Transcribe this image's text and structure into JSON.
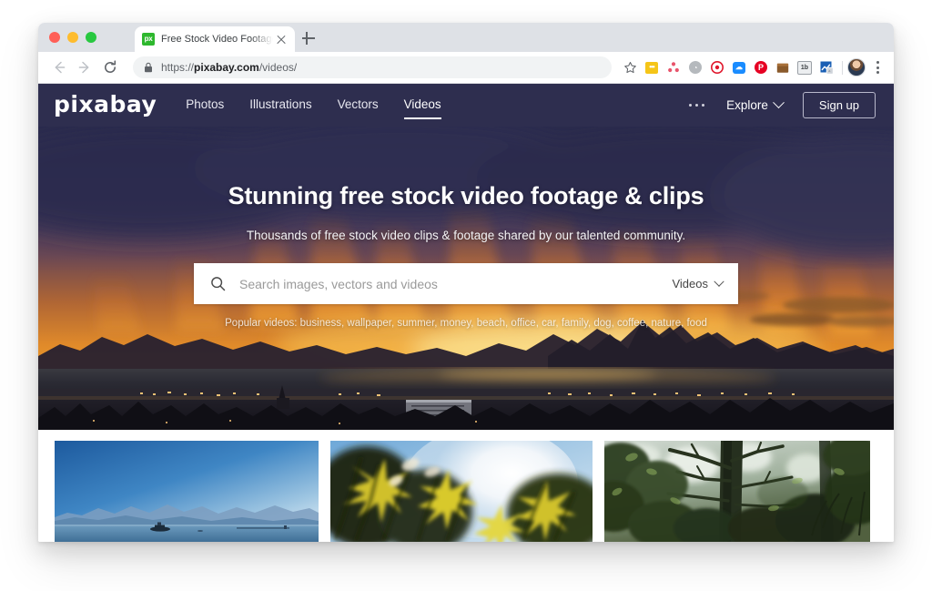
{
  "browser": {
    "traffic_lights": [
      "close",
      "minimize",
      "maximize"
    ],
    "tab": {
      "favicon_text": "px",
      "title": "Free Stock Video Footage & Vi",
      "close_icon": "close-icon"
    },
    "new_tab_icon": "plus-icon",
    "toolbar": {
      "back_icon": "arrow-left-icon",
      "forward_icon": "arrow-right-icon",
      "reload_icon": "reload-icon",
      "lock_icon": "lock-icon",
      "url_scheme": "https://",
      "url_host": "pixabay.com",
      "url_path": "/videos/",
      "bookmark_icon": "star-icon",
      "extensions": [
        {
          "name": "notes-extension-icon",
          "color": "#f5c518",
          "glyph": "•••"
        },
        {
          "name": "cluster-extension-icon",
          "color": "#e8546b",
          "glyph": ""
        },
        {
          "name": "gray-extension-icon",
          "color": "#9aa0a6",
          "glyph": ""
        },
        {
          "name": "target-extension-icon",
          "color": "#e0162b",
          "glyph": ""
        },
        {
          "name": "chat-extension-icon",
          "color": "#1a8cff",
          "glyph": ""
        },
        {
          "name": "pinterest-extension-icon",
          "color": "#e60023",
          "glyph": "P"
        },
        {
          "name": "box-extension-icon",
          "color": "#8a5a2b",
          "glyph": ""
        },
        {
          "name": "onetab-extension-icon",
          "color": "#5f6368",
          "glyph": "1b"
        },
        {
          "name": "analytics-extension-icon",
          "color": "#1a5fb4",
          "glyph": ""
        }
      ],
      "avatar": "user-avatar",
      "menu_icon": "kebab-menu-icon"
    }
  },
  "site": {
    "logo": "pixabay",
    "nav_links": [
      {
        "label": "Photos",
        "active": false
      },
      {
        "label": "Illustrations",
        "active": false
      },
      {
        "label": "Vectors",
        "active": false
      },
      {
        "label": "Videos",
        "active": true
      }
    ],
    "more_icon": "ellipsis-icon",
    "explore_label": "Explore",
    "explore_chevron": "chevron-down-icon",
    "signup_label": "Sign up",
    "nav_bg": "#2e2e4f"
  },
  "hero": {
    "title": "Stunning free stock video footage & clips",
    "subtitle": "Thousands of free stock video clips & footage shared by our talented community.",
    "search": {
      "icon": "search-icon",
      "value": "",
      "placeholder": "Search images, vectors and videos",
      "type_label": "Videos",
      "type_chevron": "chevron-down-icon"
    },
    "popular_label": "Popular videos:",
    "popular_terms": "business, wallpaper, summer, money, beach, office, car, family, dog, coffee, nature, food",
    "popular_line": "Popular videos: business, wallpaper, summer, money, beach, office, car, family, dog, coffee, nature, food",
    "background": "sunset over mountains and lake with city lights"
  },
  "thumbnails": [
    {
      "name": "video-thumbnail-lake-mountains",
      "description": "Blue sky over calm water with distant mountains and a small boat"
    },
    {
      "name": "video-thumbnail-yellow-flowers",
      "description": "Close-up of yellow flowers backlit by bright sun"
    },
    {
      "name": "video-thumbnail-forest-trees",
      "description": "Dark green forest canopy with tall tree trunks"
    }
  ]
}
